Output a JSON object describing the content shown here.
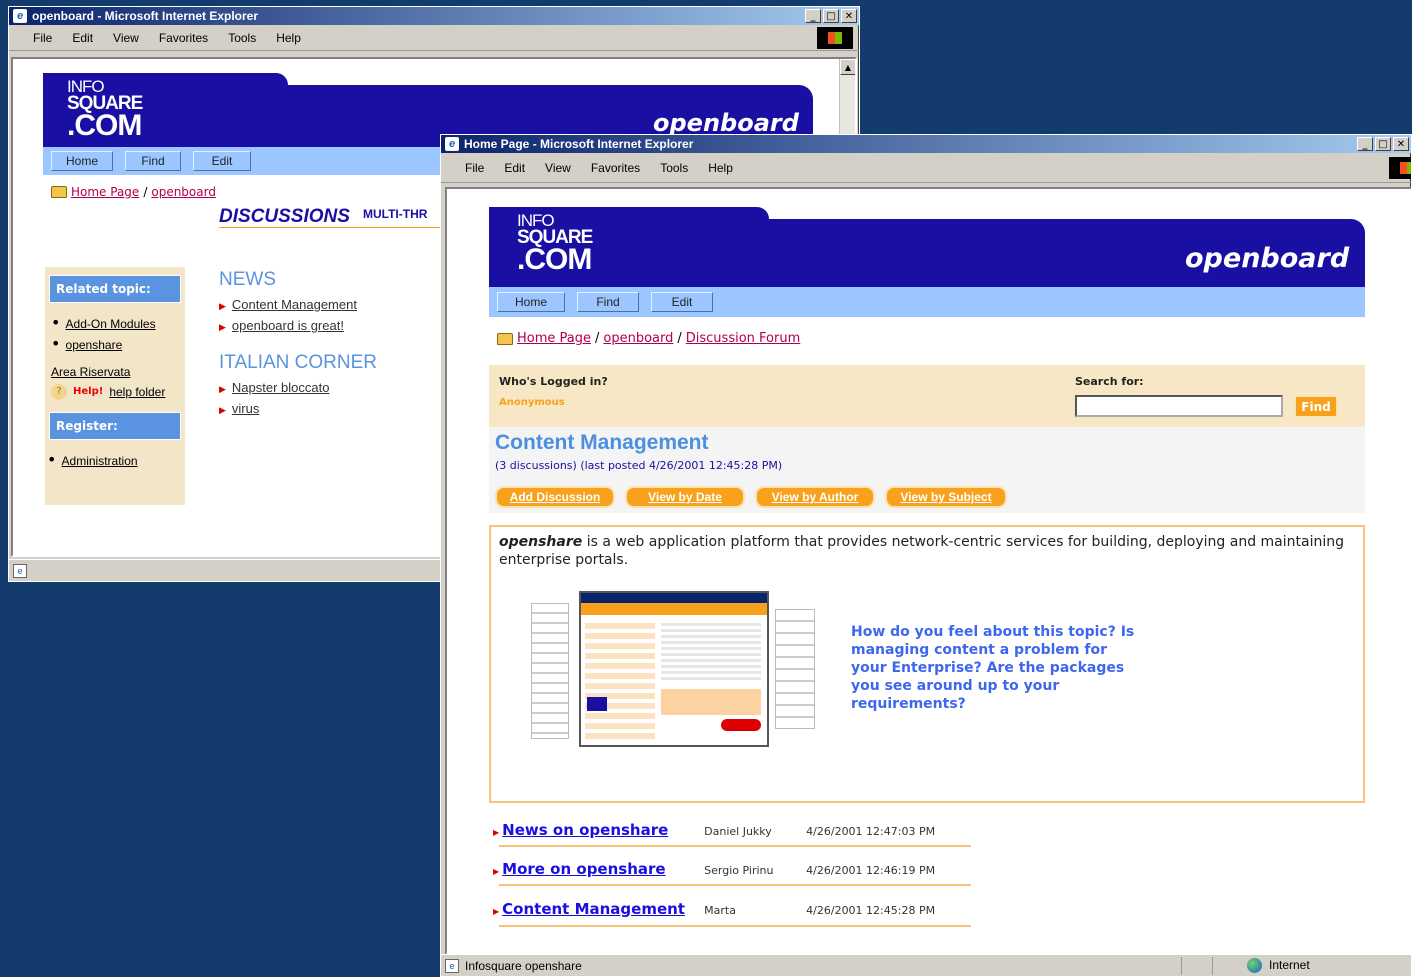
{
  "back_window": {
    "title": "openboard - Microsoft Internet Explorer",
    "menu": [
      "File",
      "Edit",
      "View",
      "Favorites",
      "Tools",
      "Help"
    ],
    "logo": {
      "line1": "INFO",
      "line2": "SQUARE",
      "line3": ".COM"
    },
    "brand": "openboard",
    "nav": [
      "Home",
      "Find",
      "Edit"
    ],
    "breadcrumb": {
      "home": "Home Page",
      "sep": "/",
      "current": "openboard"
    },
    "discussions_heading": "DISCUSSIONS",
    "multi_thread": "MULTI-THR",
    "sidebar": {
      "related_header": "Related topic:",
      "links": [
        "Add-On Modules",
        "openshare"
      ],
      "area": "Area Riservata",
      "help_badge": "Help!",
      "help_link": "help folder",
      "register_header": "Register:",
      "admin_link": "Administration"
    },
    "sections": [
      {
        "title": "NEWS",
        "items": [
          "Content Management",
          "openboard is great!"
        ]
      },
      {
        "title": "ITALIAN CORNER",
        "items": [
          "Napster bloccato",
          "virus"
        ]
      }
    ]
  },
  "front_window": {
    "title": "Home Page - Microsoft Internet Explorer",
    "menu": [
      "File",
      "Edit",
      "View",
      "Favorites",
      "Tools",
      "Help"
    ],
    "logo": {
      "line1": "INFO",
      "line2": "SQUARE",
      "line3": ".COM"
    },
    "brand": "openboard",
    "nav": [
      "Home",
      "Find",
      "Edit"
    ],
    "breadcrumb": {
      "home": "Home Page",
      "sep1": "/",
      "board": "openboard",
      "sep2": "/",
      "forum": "Discussion Forum"
    },
    "login": {
      "label": "Who's Logged in?",
      "user": "Anonymous",
      "search_label": "Search for:",
      "search_value": "",
      "find_button": "Find"
    },
    "topic": {
      "title": "Content Management",
      "meta": "(3 discussions) (last posted 4/26/2001 12:45:28 PM)",
      "buttons": [
        "Add Discussion",
        "View by Date",
        "View by Author",
        "View by Subject"
      ],
      "desc_brand": "openshare",
      "desc_text": " is a web application platform that provides network-centric services for building, deploying and maintaining enterprise portals.",
      "question": "How do you feel about this topic? Is managing content a problem for your Enterprise? Are the packages you see around up to your requirements?"
    },
    "discussions": [
      {
        "title": "News on openshare",
        "author": "Daniel Jukky",
        "date": "4/26/2001 12:47:03 PM"
      },
      {
        "title": "More on openshare",
        "author": "Sergio Pirinu",
        "date": "4/26/2001 12:46:19 PM"
      },
      {
        "title": "Content Management",
        "author": "Marta",
        "date": "4/26/2001 12:45:28 PM"
      }
    ],
    "status": {
      "text": "Infosquare openshare",
      "zone": "Internet"
    }
  },
  "colors": {
    "desktop": "#133b6b",
    "header_blue": "#1a0fa3",
    "nav_blue": "#9cc6ff",
    "accent_orange": "#f8a11c",
    "link_red": "#b0004c"
  }
}
